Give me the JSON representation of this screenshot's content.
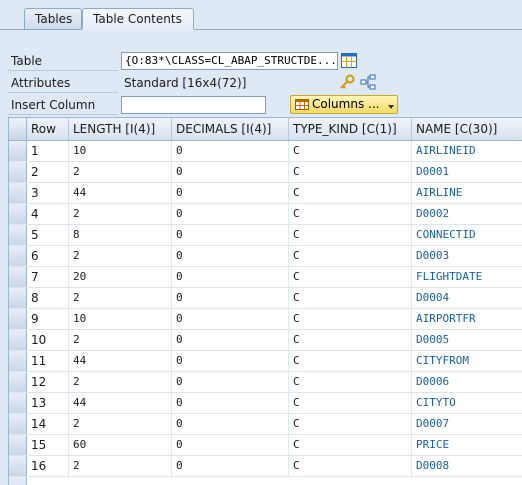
{
  "tabs": [
    {
      "label": "Tables"
    },
    {
      "label": "Table Contents"
    }
  ],
  "form": {
    "table_label": "Table",
    "table_value": "{O:83*\\CLASS=CL_ABAP_STRUCTDE...",
    "attributes_label": "Attributes",
    "attributes_value": "Standard [16x4(72)]",
    "insert_column_label": "Insert Column",
    "insert_column_value": "",
    "columns_button_label": "Columns ..."
  },
  "table": {
    "headers": [
      "Row",
      "LENGTH [I(4)]",
      "DECIMALS [I(4)]",
      "TYPE_KIND [C(1)]",
      "NAME [C(30)]"
    ],
    "rows": [
      {
        "row": "1",
        "length": "10",
        "decimals": "0",
        "type_kind": "C",
        "name": "AIRLINEID"
      },
      {
        "row": "2",
        "length": "2",
        "decimals": "0",
        "type_kind": "C",
        "name": "D0001"
      },
      {
        "row": "3",
        "length": "44",
        "decimals": "0",
        "type_kind": "C",
        "name": "AIRLINE"
      },
      {
        "row": "4",
        "length": "2",
        "decimals": "0",
        "type_kind": "C",
        "name": "D0002"
      },
      {
        "row": "5",
        "length": "8",
        "decimals": "0",
        "type_kind": "C",
        "name": "CONNECTID"
      },
      {
        "row": "6",
        "length": "2",
        "decimals": "0",
        "type_kind": "C",
        "name": "D0003"
      },
      {
        "row": "7",
        "length": "20",
        "decimals": "0",
        "type_kind": "C",
        "name": "FLIGHTDATE"
      },
      {
        "row": "8",
        "length": "2",
        "decimals": "0",
        "type_kind": "C",
        "name": "D0004"
      },
      {
        "row": "9",
        "length": "10",
        "decimals": "0",
        "type_kind": "C",
        "name": "AIRPORTFR"
      },
      {
        "row": "10",
        "length": "2",
        "decimals": "0",
        "type_kind": "C",
        "name": "D0005"
      },
      {
        "row": "11",
        "length": "44",
        "decimals": "0",
        "type_kind": "C",
        "name": "CITYFROM"
      },
      {
        "row": "12",
        "length": "2",
        "decimals": "0",
        "type_kind": "C",
        "name": "D0006"
      },
      {
        "row": "13",
        "length": "44",
        "decimals": "0",
        "type_kind": "C",
        "name": "CITYTO"
      },
      {
        "row": "14",
        "length": "2",
        "decimals": "0",
        "type_kind": "C",
        "name": "D0007"
      },
      {
        "row": "15",
        "length": "60",
        "decimals": "0",
        "type_kind": "C",
        "name": "PRICE"
      },
      {
        "row": "16",
        "length": "2",
        "decimals": "0",
        "type_kind": "C",
        "name": "D0008"
      }
    ]
  },
  "icons": {
    "table_icon": "table-grid-icon",
    "key_icon": "key-icon",
    "structure_icon": "structure-icon",
    "columns_icon": "table-grid-icon"
  },
  "colors": {
    "background": "#dfe9f5",
    "name_text": "#1a5f9a",
    "button_yellow": "#f4d96a"
  }
}
